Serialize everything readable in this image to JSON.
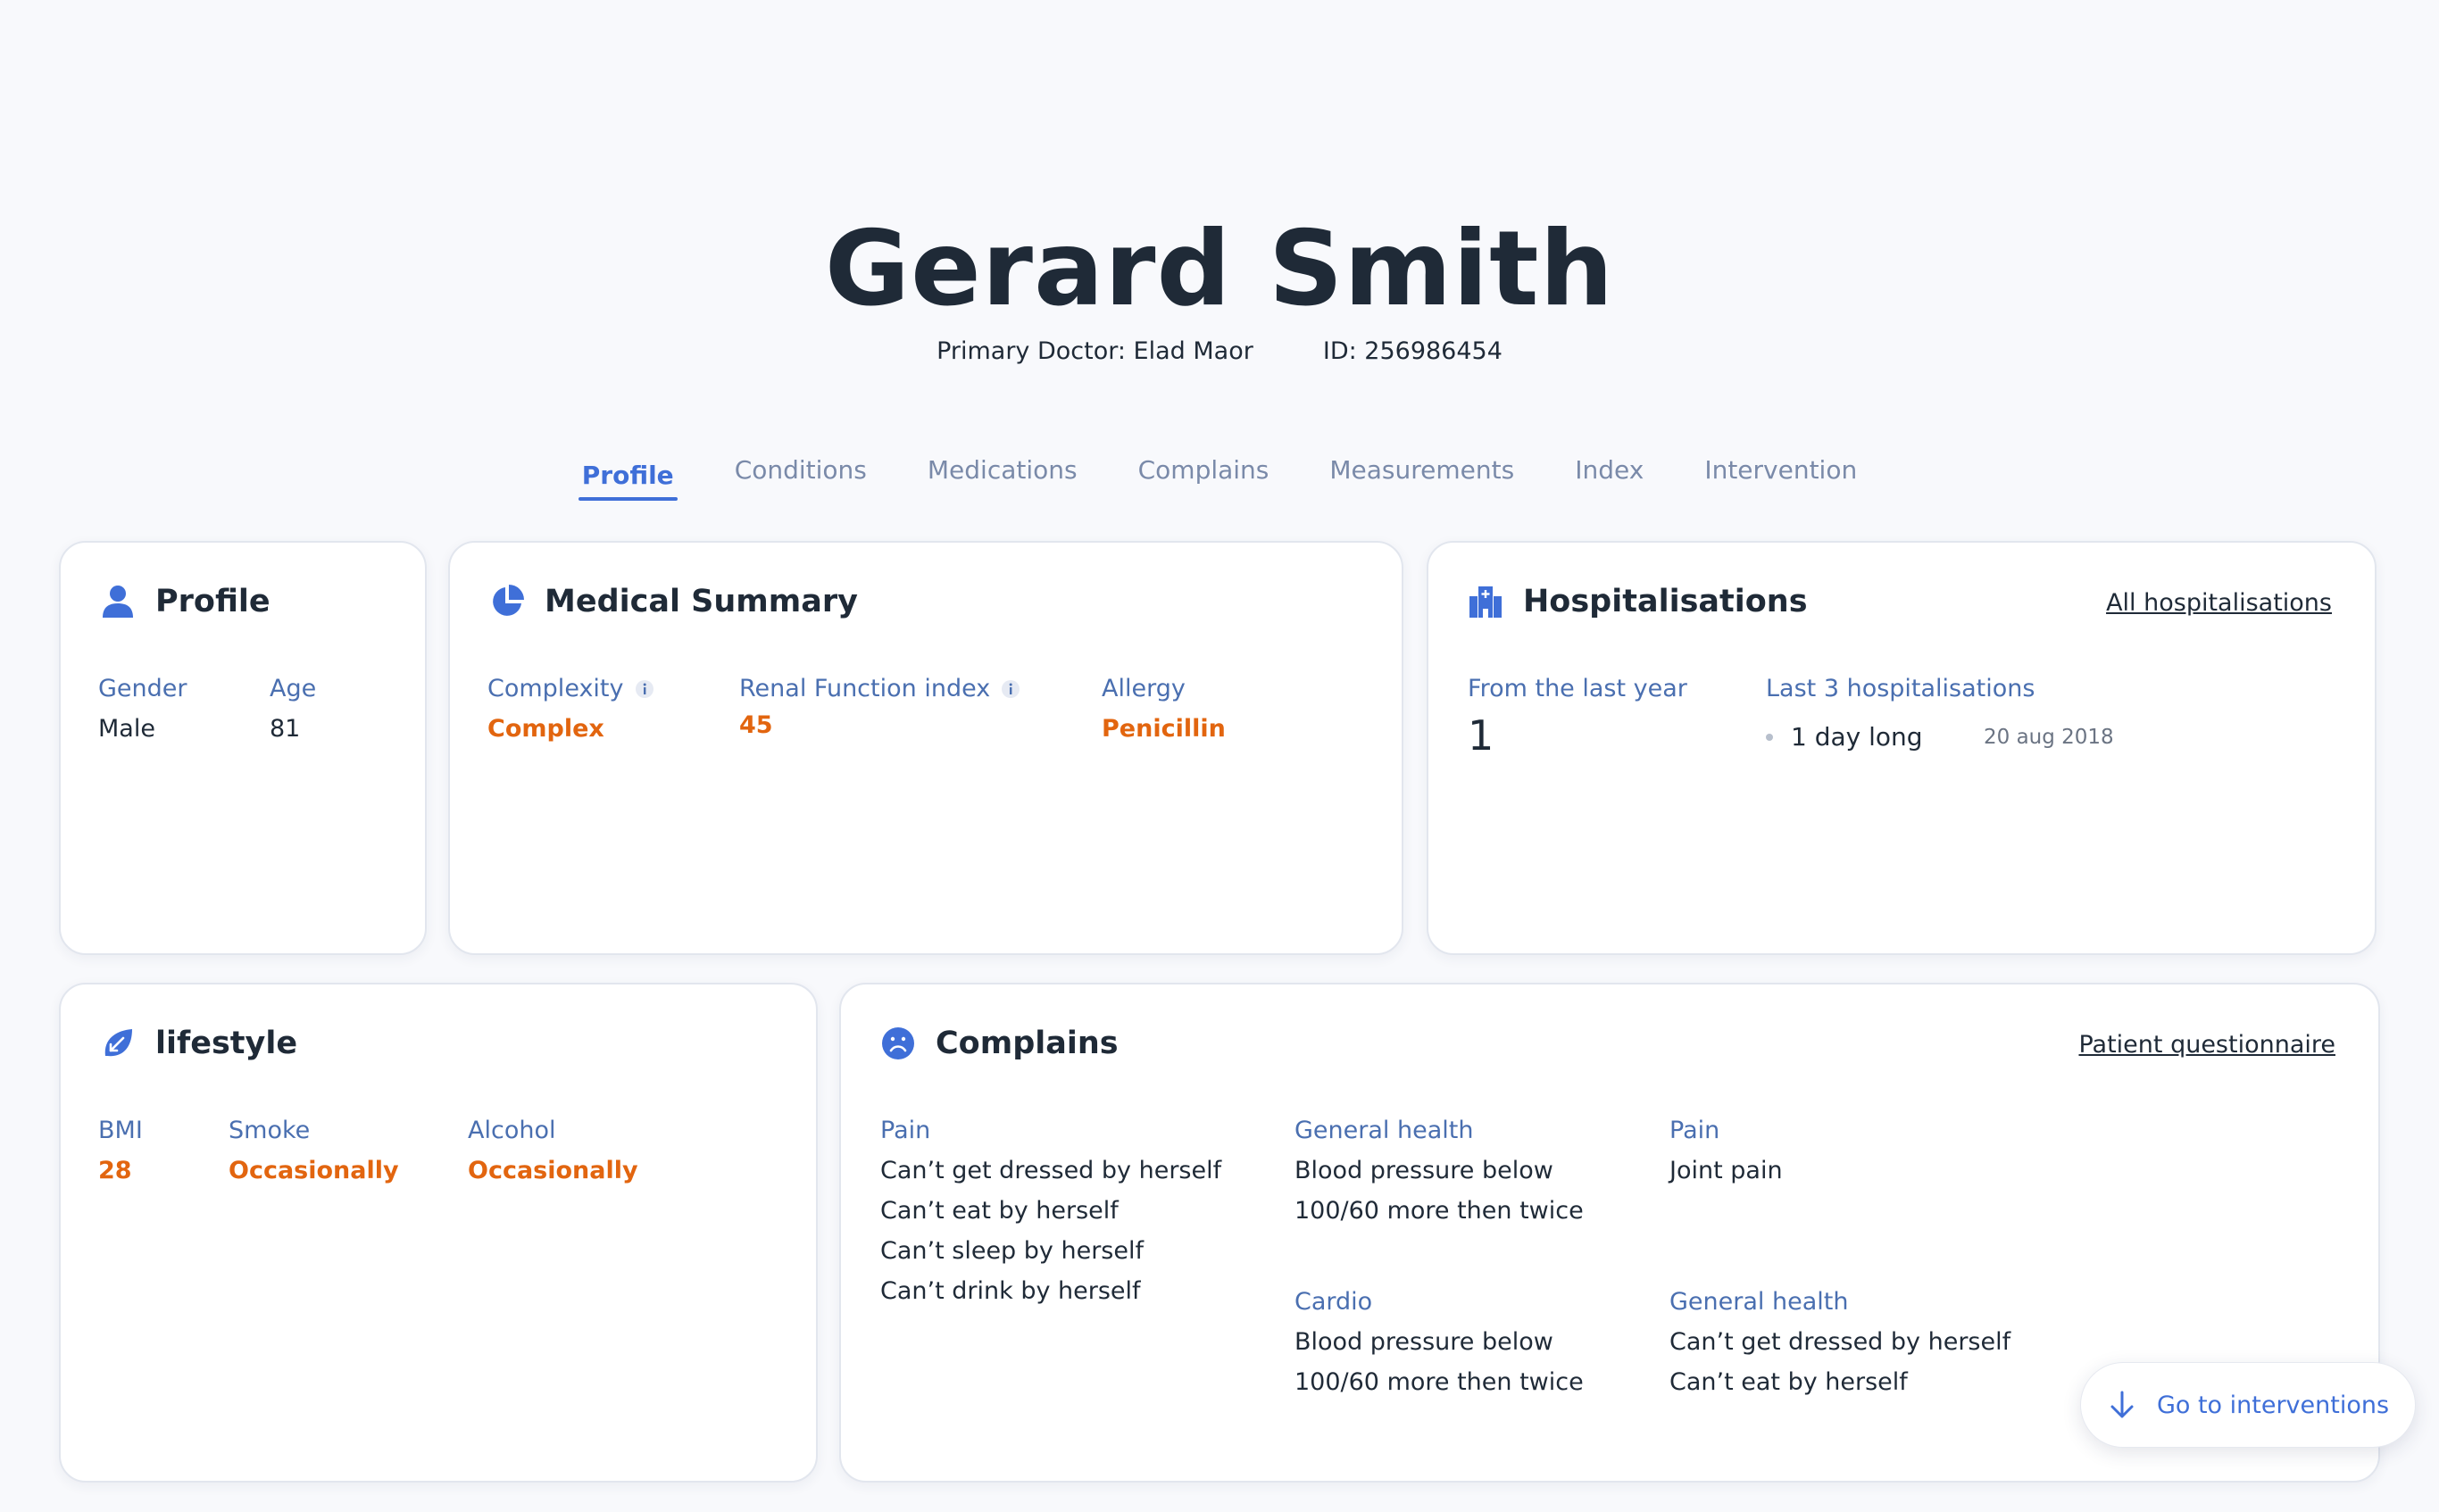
{
  "patient": {
    "name": "Gerard Smith",
    "primary_doctor": "Primary Doctor: Elad Maor",
    "id": "ID: 256986454"
  },
  "tabs": [
    {
      "label": "Profile",
      "active": true
    },
    {
      "label": "Conditions"
    },
    {
      "label": "Medications"
    },
    {
      "label": "Complains"
    },
    {
      "label": "Measurements"
    },
    {
      "label": "Index"
    },
    {
      "label": "Intervention"
    }
  ],
  "profile": {
    "title": "Profile",
    "icon": "person-icon",
    "gender_label": "Gender",
    "gender_value": "Male",
    "age_label": "Age",
    "age_value": "81"
  },
  "medical_summary": {
    "title": "Medical Summary",
    "icon": "pie-chart-icon",
    "complexity_label": "Complexity",
    "complexity_value": "Complex",
    "renal_label": "Renal Function index",
    "renal_value": "45",
    "allergy_label": "Allergy",
    "allergy_value": "Penicillin"
  },
  "hospitalisations": {
    "title": "Hospitalisations",
    "icon": "hospital-icon",
    "link": "All hospitalisations",
    "last_year_label": "From the last year",
    "last_year_value": "1",
    "last3_label": "Last 3 hospitalisations",
    "items": [
      {
        "duration": "1 day long",
        "date": "20 aug 2018"
      }
    ]
  },
  "lifestyle": {
    "title": "lifestyle",
    "icon": "leaf-icon",
    "bmi_label": "BMI",
    "bmi_value": "28",
    "smoke_label": "Smoke",
    "smoke_value": "Occasionally",
    "alcohol_label": "Alcohol",
    "alcohol_value": "Occasionally"
  },
  "complains": {
    "title": "Complains",
    "icon": "sad-face-icon",
    "link": "Patient questionnaire",
    "groups": [
      {
        "label": "Pain",
        "lines": [
          "Can’t get dressed by herself",
          "Can’t eat by herself",
          "Can’t sleep by herself",
          "Can’t drink by herself"
        ]
      },
      {
        "label": "General health",
        "lines": [
          "Blood pressure below",
          "100/60 more then twice"
        ]
      },
      {
        "label": "Pain",
        "lines": [
          "Joint pain"
        ]
      },
      {
        "label": "Cardio",
        "lines": [
          "Blood pressure below",
          "100/60 more then twice"
        ]
      },
      {
        "label": "General health",
        "lines": [
          "Can’t get dressed by herself",
          "Can’t eat by herself"
        ]
      }
    ]
  },
  "fab": {
    "label": "Go to interventions",
    "icon": "arrow-down-icon"
  },
  "colors": {
    "accent": "#3f6fd8",
    "label": "#4a6fb0",
    "warning": "#e2650f",
    "tab_inactive": "#7a8aa9"
  }
}
